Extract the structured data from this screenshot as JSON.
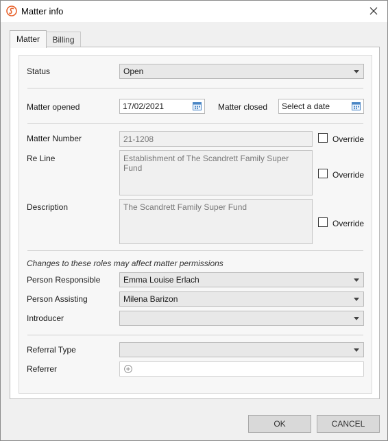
{
  "window": {
    "title": "Matter info"
  },
  "tabs": [
    {
      "label": "Matter",
      "active": true
    },
    {
      "label": "Billing",
      "active": false
    }
  ],
  "form": {
    "status": {
      "label": "Status",
      "value": "Open"
    },
    "matter_opened": {
      "label": "Matter opened",
      "value": "17/02/2021"
    },
    "matter_closed": {
      "label": "Matter closed",
      "placeholder": "Select a date"
    },
    "matter_number": {
      "label": "Matter Number",
      "value": "21-1208",
      "override_label": "Override",
      "override_checked": false
    },
    "re_line": {
      "label": "Re Line",
      "value": "Establishment of The Scandrett Family Super Fund",
      "override_label": "Override",
      "override_checked": false
    },
    "description": {
      "label": "Description",
      "value": "The Scandrett Family Super Fund",
      "override_label": "Override",
      "override_checked": false
    },
    "roles_note": "Changes to these roles may affect matter permissions",
    "person_responsible": {
      "label": "Person Responsible",
      "value": "Emma Louise Erlach"
    },
    "person_assisting": {
      "label": "Person Assisting",
      "value": "Milena Barizon"
    },
    "introducer": {
      "label": "Introducer",
      "value": ""
    },
    "referral_type": {
      "label": "Referral Type",
      "value": ""
    },
    "referrer": {
      "label": "Referrer"
    }
  },
  "buttons": {
    "ok": "OK",
    "cancel": "CANCEL"
  },
  "colors": {
    "brand": "#e8622c",
    "accent": "#4a86c5"
  }
}
